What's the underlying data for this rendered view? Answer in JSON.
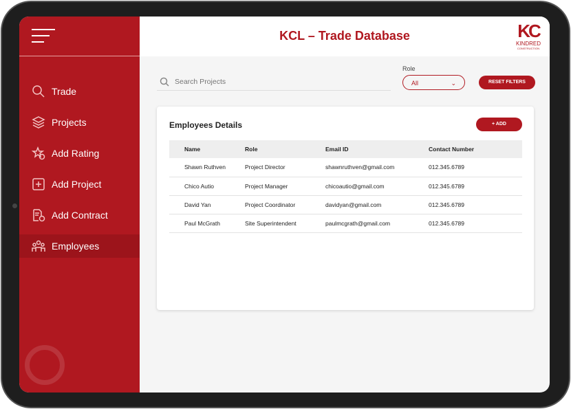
{
  "header": {
    "title": "KCL – Trade Database",
    "logo_text": "KC",
    "logo_sub1": "KINDRED",
    "logo_sub2": "CONSTRUCTION"
  },
  "sidebar": {
    "items": [
      {
        "label": "Trade",
        "icon": "search-icon"
      },
      {
        "label": "Projects",
        "icon": "layers-icon"
      },
      {
        "label": "Add Rating",
        "icon": "star-plus-icon"
      },
      {
        "label": "Add Project",
        "icon": "square-plus-icon"
      },
      {
        "label": "Add Contract",
        "icon": "document-plus-icon"
      },
      {
        "label": "Employees",
        "icon": "people-icon",
        "active": true
      }
    ]
  },
  "filters": {
    "search_placeholder": "Search Projects",
    "role_label": "Role",
    "role_value": "All",
    "reset_label": "RESET FILTERS"
  },
  "card": {
    "title": "Employees Details",
    "add_label": "+ ADD",
    "columns": [
      "Name",
      "Role",
      "Email ID",
      "Contact Number"
    ],
    "rows": [
      [
        "Shawn Ruthven",
        "Project Director",
        "shawnruthven@gmail.com",
        "012.345.6789"
      ],
      [
        "Chico Autio",
        "Project Manager",
        "chicoautio@gmail.com",
        "012.345.6789"
      ],
      [
        "David Yan",
        "Project Coordinator",
        "davidyan@gmail.com",
        "012.345.6789"
      ],
      [
        "Paul McGrath",
        "Site Superintendent",
        "paulmcgrath@gmail.com",
        "012.345.6789"
      ]
    ]
  },
  "colors": {
    "brand": "#b01820"
  }
}
